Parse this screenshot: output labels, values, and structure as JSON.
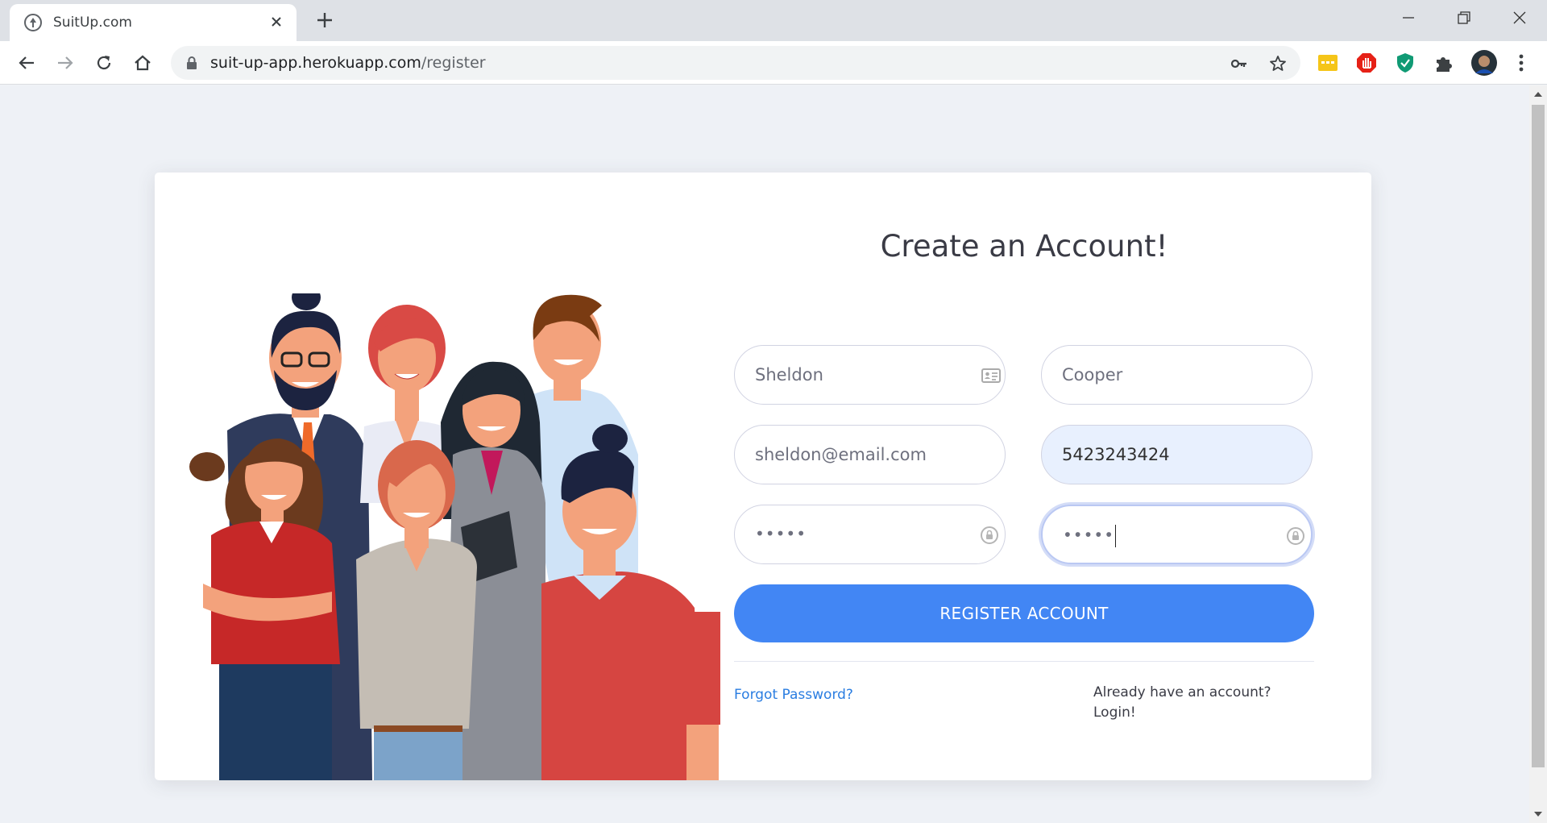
{
  "browser": {
    "tab_title": "SuitUp.com",
    "url_host": "suit-up-app.herokuapp.com",
    "url_path": "/register"
  },
  "page": {
    "title": "Create an Account!",
    "fields": {
      "first_name": "Sheldon",
      "last_name": "Cooper",
      "email": "sheldon@email.com",
      "phone": "5423243424",
      "password": "•••••",
      "repeat_password": "•••••"
    },
    "register_label": "REGISTER ACCOUNT",
    "forgot_password": "Forgot Password?",
    "login_line1": "Already have an account?",
    "login_line2": "Login!"
  },
  "colors": {
    "primary": "#4286f4",
    "link": "#2a7de1",
    "autofill": "#e8f0fe",
    "page_bg": "#eef1f6"
  },
  "icons": [
    "suitup-favicon",
    "close-icon",
    "plus-icon",
    "back-icon",
    "forward-icon",
    "reload-icon",
    "home-icon",
    "lock-icon",
    "key-icon",
    "star-icon",
    "extension-icons",
    "profile-avatar",
    "menu-icon",
    "contact-card-icon",
    "password-manager-icon"
  ]
}
